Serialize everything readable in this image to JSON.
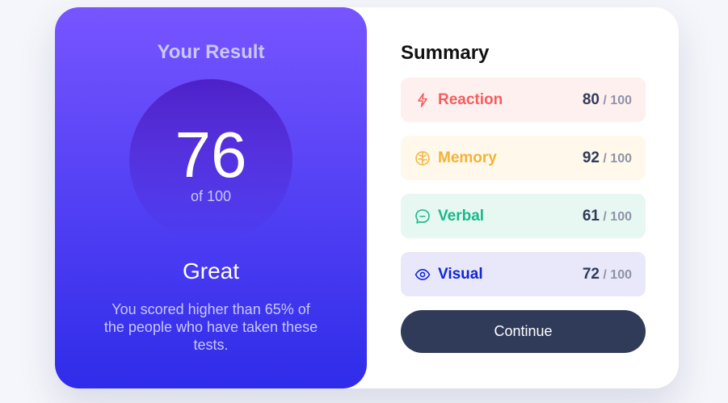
{
  "result": {
    "title": "Your Result",
    "score": "76",
    "score_of": "of 100",
    "verdict": "Great",
    "blurb": "You scored higher than 65% of the people who have taken these tests."
  },
  "summary": {
    "title": "Summary",
    "items": [
      {
        "label": "Reaction",
        "score": "80",
        "max": " / 100",
        "icon": "lightning-icon",
        "color": "#f55d5d",
        "bg": "#fff0f0"
      },
      {
        "label": "Memory",
        "score": "92",
        "max": " / 100",
        "icon": "brain-icon",
        "color": "#f4b335",
        "bg": "#fff8eb"
      },
      {
        "label": "Verbal",
        "score": "61",
        "max": " / 100",
        "icon": "chat-bubble-icon",
        "color": "#19b989",
        "bg": "#e7f7f2"
      },
      {
        "label": "Visual",
        "score": "72",
        "max": " / 100",
        "icon": "eye-icon",
        "color": "#1125d6",
        "bg": "#e8e8fa"
      }
    ]
  },
  "continue_label": "Continue"
}
